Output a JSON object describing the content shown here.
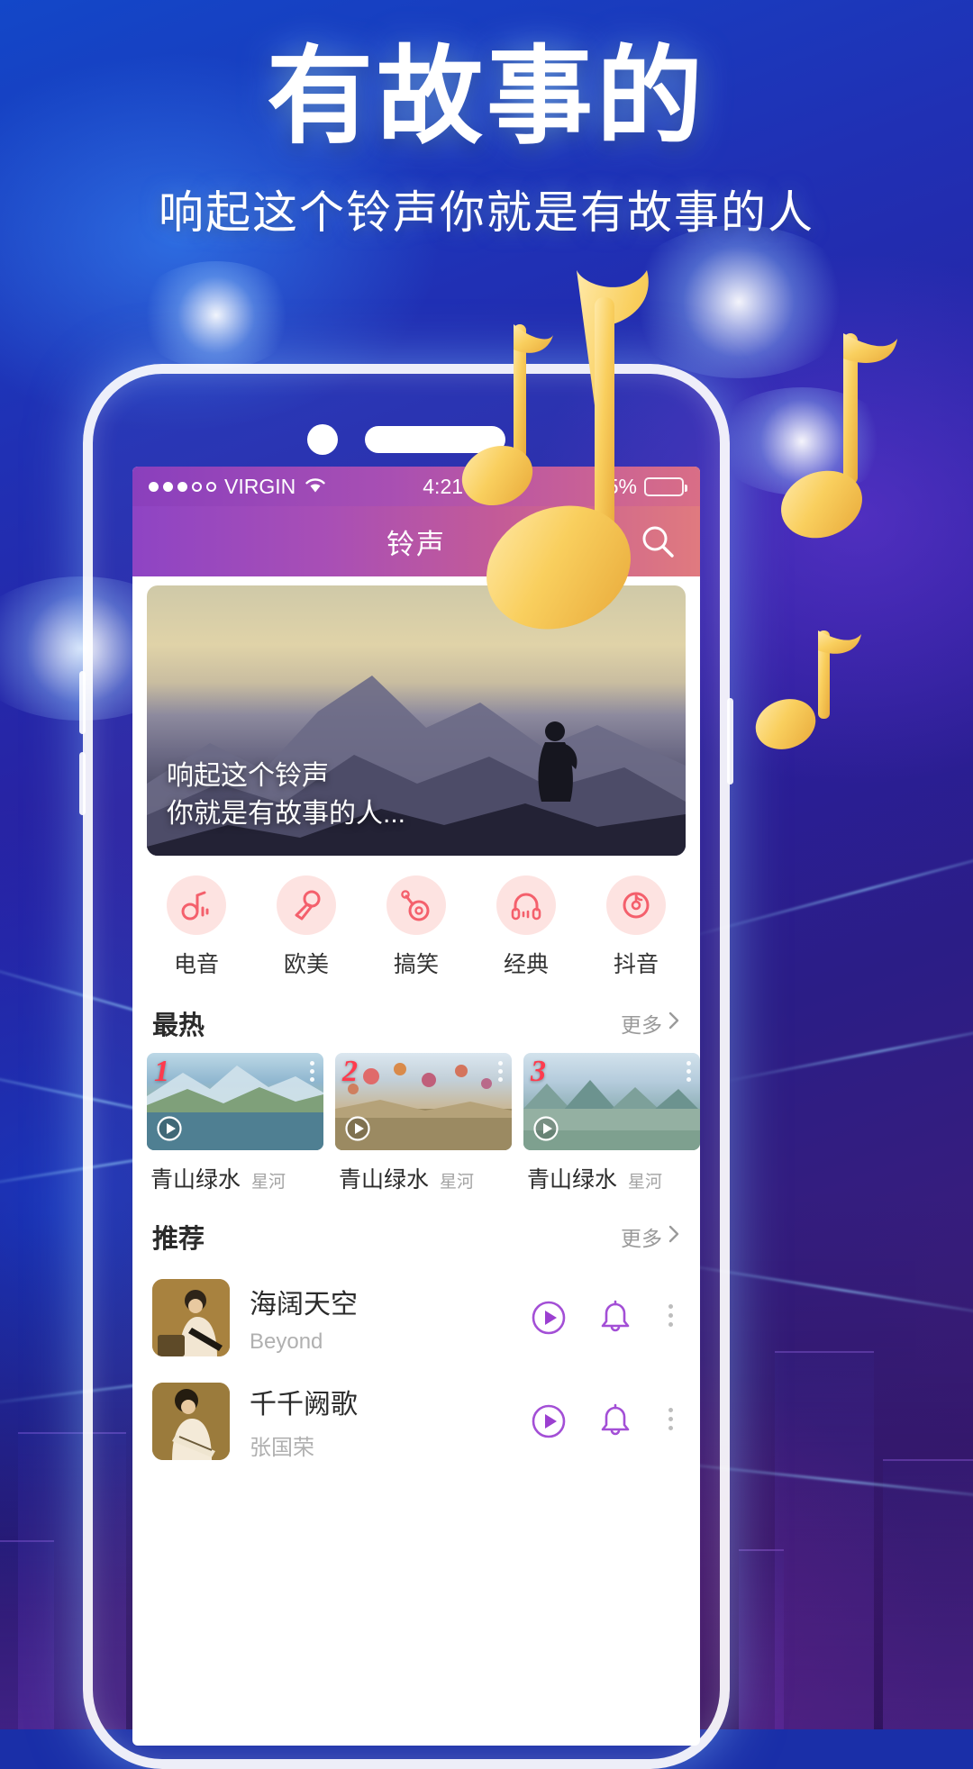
{
  "poster": {
    "headline": "有故事的",
    "subheadline": "响起这个铃声你就是有故事的人"
  },
  "colors": {
    "accent_pink": "#ff6b6b",
    "accent_purple": "#9b4fd4",
    "rank_red": "#ff3b4e",
    "nav_gradient_start": "#8e44c4",
    "nav_gradient_end": "#e07a7f",
    "category_bubble": "#fde3e1"
  },
  "statusbar": {
    "signal_dots_filled": 3,
    "signal_dots_total": 5,
    "carrier": "VIRGIN",
    "wifi_icon": "wifi-icon",
    "time": "4:21 PM",
    "battery_percent": "95%",
    "battery_level": 95
  },
  "navbar": {
    "title": "铃声",
    "search_icon": "search-icon"
  },
  "hero": {
    "line1": "响起这个铃声",
    "line2": "你就是有故事的人..."
  },
  "categories": [
    {
      "label": "电音",
      "icon": "music-note-icon"
    },
    {
      "label": "欧美",
      "icon": "microphone-icon"
    },
    {
      "label": "搞笑",
      "icon": "guitar-icon"
    },
    {
      "label": "经典",
      "icon": "headphones-icon"
    },
    {
      "label": "抖音",
      "icon": "tiktok-record-icon"
    }
  ],
  "hot": {
    "title": "最热",
    "more_label": "更多",
    "more_icon": "chevron-right-icon",
    "cards": [
      {
        "rank": "1",
        "title": "青山绿水",
        "subtitle": "星河",
        "play_icon": "play-icon",
        "menu_icon": "kebab-menu-icon"
      },
      {
        "rank": "2",
        "title": "青山绿水",
        "subtitle": "星河",
        "play_icon": "play-icon",
        "menu_icon": "kebab-menu-icon"
      },
      {
        "rank": "3",
        "title": "青山绿水",
        "subtitle": "星河",
        "play_icon": "play-icon",
        "menu_icon": "kebab-menu-icon"
      }
    ]
  },
  "recommend": {
    "title": "推荐",
    "more_label": "更多",
    "more_icon": "chevron-right-icon",
    "items": [
      {
        "title": "海阔天空",
        "artist": "Beyond",
        "play_icon": "play-icon",
        "bell_icon": "bell-icon",
        "menu_icon": "kebab-menu-icon"
      },
      {
        "title": "千千阙歌",
        "artist": "张国荣",
        "play_icon": "play-icon",
        "bell_icon": "bell-icon",
        "menu_icon": "kebab-menu-icon"
      }
    ]
  }
}
